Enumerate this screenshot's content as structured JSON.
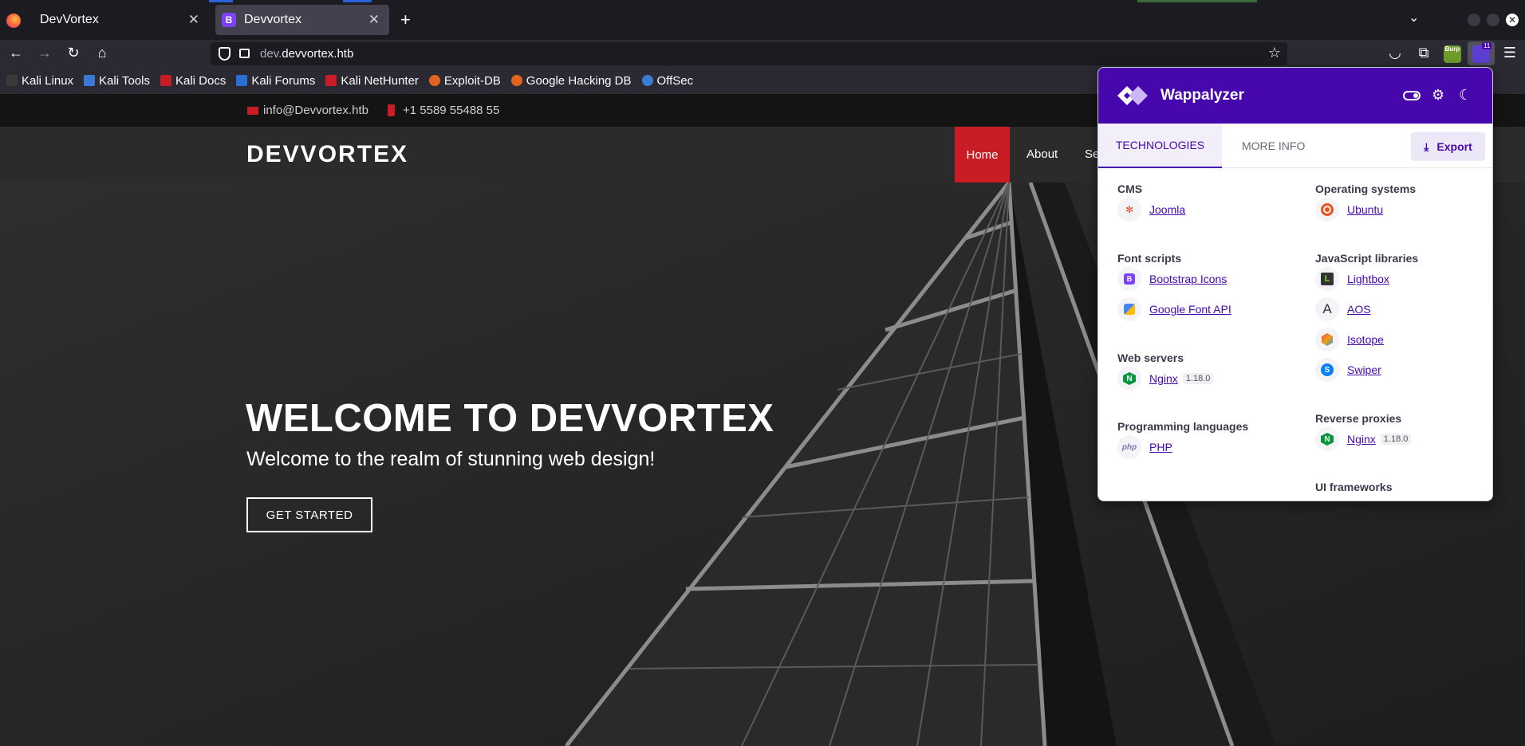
{
  "tabs": [
    {
      "title": "DevVortex"
    },
    {
      "title": "Devvortex",
      "favicon": "B"
    }
  ],
  "urlbar": {
    "url_dim": "dev.",
    "url_main": "devvortex.htb"
  },
  "bookmarks": [
    "Kali Linux",
    "Kali Tools",
    "Kali Docs",
    "Kali Forums",
    "Kali NetHunter",
    "Exploit-DB",
    "Google Hacking DB",
    "OffSec"
  ],
  "extensions": {
    "burp_label": "Burp",
    "wappalyzer_badge": "11"
  },
  "site": {
    "email": "info@Devvortex.htb",
    "phone": "+1 5589 55488 55",
    "logo": "DEVVORTEX",
    "menu": {
      "home": "Home",
      "about": "About",
      "next": "Se"
    },
    "hero_title": "WELCOME TO DEVVORTEX",
    "hero_subtitle": "Welcome to the realm of stunning web design!",
    "hero_button": "GET STARTED",
    "accent_color": "#c81d25"
  },
  "wappalyzer": {
    "name": "Wappalyzer",
    "tab_technologies": "TECHNOLOGIES",
    "tab_more_info": "MORE INFO",
    "export": "Export",
    "brand_color": "#4608ad",
    "left": [
      {
        "category": "CMS",
        "items": [
          {
            "name": "Joomla",
            "icon": "joomla-icon"
          }
        ]
      },
      {
        "category": "Font scripts",
        "items": [
          {
            "name": "Bootstrap Icons",
            "icon": "bootstrap-icon"
          },
          {
            "name": "Google Font API",
            "icon": "google-fonts-icon"
          }
        ]
      },
      {
        "category": "Web servers",
        "items": [
          {
            "name": "Nginx",
            "version": "1.18.0",
            "icon": "nginx-icon"
          }
        ]
      },
      {
        "category": "Programming languages",
        "items": [
          {
            "name": "PHP",
            "icon": "php-icon"
          }
        ]
      }
    ],
    "right": [
      {
        "category": "Operating systems",
        "items": [
          {
            "name": "Ubuntu",
            "icon": "ubuntu-icon"
          }
        ]
      },
      {
        "category": "JavaScript libraries",
        "items": [
          {
            "name": "Lightbox",
            "icon": "lightbox-icon"
          },
          {
            "name": "AOS",
            "icon": "aos-icon"
          },
          {
            "name": "Isotope",
            "icon": "isotope-icon"
          },
          {
            "name": "Swiper",
            "icon": "swiper-icon"
          }
        ]
      },
      {
        "category": "Reverse proxies",
        "items": [
          {
            "name": "Nginx",
            "version": "1.18.0",
            "icon": "nginx-icon"
          }
        ]
      },
      {
        "category": "UI frameworks",
        "items": []
      }
    ]
  }
}
